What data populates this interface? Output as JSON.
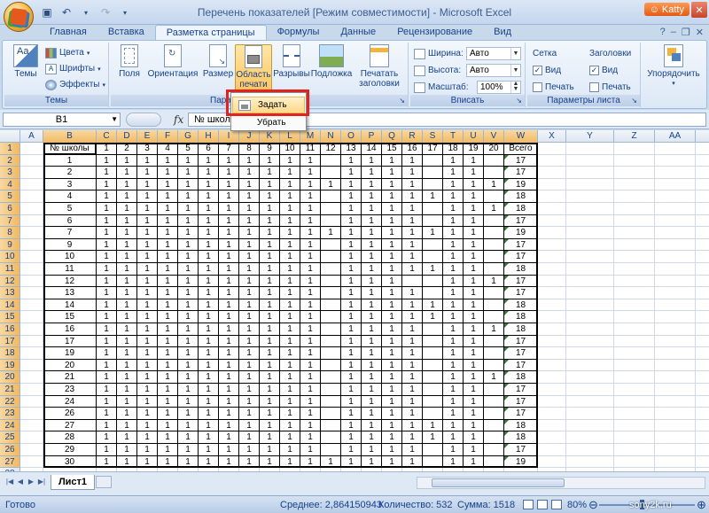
{
  "window": {
    "title": "Перечень показателей  [Режим совместимости] - Microsoft Excel",
    "user_badge": "Katty"
  },
  "ribbon": {
    "tabs": [
      "Главная",
      "Вставка",
      "Разметка страницы",
      "Формулы",
      "Данные",
      "Рецензирование",
      "Вид"
    ],
    "active_tab": "Разметка страницы",
    "themes": {
      "big_label": "Темы",
      "colors": "Цвета",
      "fonts": "Шрифты",
      "effects": "Эффекты",
      "group_label": "Темы"
    },
    "page_setup": {
      "margins": "Поля",
      "orientation": "Ориентация",
      "size": "Размер",
      "print_area": "Область печати",
      "breaks": "Разрывы",
      "background": "Подложка",
      "print_titles": "Печатать заголовки",
      "group_label": "Парам"
    },
    "fit": {
      "width_label": "Ширина:",
      "width_value": "Авто",
      "height_label": "Высота:",
      "height_value": "Авто",
      "scale_label": "Масштаб:",
      "scale_value": "100%",
      "group_label": "Вписать"
    },
    "sheet_options": {
      "gridlines": "Сетка",
      "headings": "Заголовки",
      "view": "Вид",
      "print": "Печать",
      "group_label": "Параметры листа"
    },
    "arrange": {
      "label": "Упорядочить"
    }
  },
  "print_area_menu": {
    "set": "Задать",
    "clear": "Убрать"
  },
  "formula_bar": {
    "name_box": "B1",
    "fx": "fx",
    "content": "№ школ"
  },
  "grid": {
    "columns": [
      "A",
      "B",
      "C",
      "D",
      "E",
      "F",
      "G",
      "H",
      "I",
      "J",
      "K",
      "L",
      "M",
      "N",
      "O",
      "P",
      "Q",
      "R",
      "S",
      "T",
      "U",
      "V",
      "W",
      "X",
      "Y",
      "Z",
      "AA",
      "AB"
    ],
    "header_row": [
      "№ школы",
      "1",
      "2",
      "3",
      "4",
      "5",
      "6",
      "7",
      "8",
      "9",
      "10",
      "11",
      "12",
      "13",
      "14",
      "15",
      "16",
      "17",
      "18",
      "19",
      "20",
      "Всего"
    ],
    "rows": [
      {
        "n": "1",
        "v": [
          "1",
          "1",
          "1",
          "1",
          "1",
          "1",
          "1",
          "1",
          "1",
          "1",
          "1",
          "",
          "1",
          "1",
          "1",
          "1",
          "",
          "1",
          "1",
          "",
          "17"
        ]
      },
      {
        "n": "2",
        "v": [
          "1",
          "1",
          "1",
          "1",
          "1",
          "1",
          "1",
          "1",
          "1",
          "1",
          "1",
          "",
          "1",
          "1",
          "1",
          "1",
          "",
          "1",
          "1",
          "",
          "17"
        ]
      },
      {
        "n": "3",
        "v": [
          "1",
          "1",
          "1",
          "1",
          "1",
          "1",
          "1",
          "1",
          "1",
          "1",
          "1",
          "1",
          "1",
          "1",
          "1",
          "1",
          "",
          "1",
          "1",
          "1",
          "19"
        ]
      },
      {
        "n": "4",
        "v": [
          "1",
          "1",
          "1",
          "1",
          "1",
          "1",
          "1",
          "1",
          "1",
          "1",
          "1",
          "",
          "1",
          "1",
          "1",
          "1",
          "1",
          "1",
          "1",
          "",
          "18"
        ]
      },
      {
        "n": "5",
        "v": [
          "1",
          "1",
          "1",
          "1",
          "1",
          "1",
          "1",
          "1",
          "1",
          "1",
          "1",
          "",
          "1",
          "1",
          "1",
          "1",
          "",
          "1",
          "1",
          "1",
          "18"
        ]
      },
      {
        "n": "6",
        "v": [
          "1",
          "1",
          "1",
          "1",
          "1",
          "1",
          "1",
          "1",
          "1",
          "1",
          "1",
          "",
          "1",
          "1",
          "1",
          "1",
          "",
          "1",
          "1",
          "",
          "17"
        ]
      },
      {
        "n": "7",
        "v": [
          "1",
          "1",
          "1",
          "1",
          "1",
          "1",
          "1",
          "1",
          "1",
          "1",
          "1",
          "1",
          "1",
          "1",
          "1",
          "1",
          "1",
          "1",
          "1",
          "",
          "19"
        ]
      },
      {
        "n": "9",
        "v": [
          "1",
          "1",
          "1",
          "1",
          "1",
          "1",
          "1",
          "1",
          "1",
          "1",
          "1",
          "",
          "1",
          "1",
          "1",
          "1",
          "",
          "1",
          "1",
          "",
          "17"
        ]
      },
      {
        "n": "10",
        "v": [
          "1",
          "1",
          "1",
          "1",
          "1",
          "1",
          "1",
          "1",
          "1",
          "1",
          "1",
          "",
          "1",
          "1",
          "1",
          "1",
          "",
          "1",
          "1",
          "",
          "17"
        ]
      },
      {
        "n": "11",
        "v": [
          "1",
          "1",
          "1",
          "1",
          "1",
          "1",
          "1",
          "1",
          "1",
          "1",
          "1",
          "",
          "1",
          "1",
          "1",
          "1",
          "1",
          "1",
          "1",
          "",
          "18"
        ]
      },
      {
        "n": "12",
        "v": [
          "1",
          "1",
          "1",
          "1",
          "1",
          "1",
          "1",
          "1",
          "1",
          "1",
          "1",
          "",
          "1",
          "1",
          "1",
          "",
          "",
          "1",
          "1",
          "1",
          "17"
        ]
      },
      {
        "n": "13",
        "v": [
          "1",
          "1",
          "1",
          "1",
          "1",
          "1",
          "1",
          "1",
          "1",
          "1",
          "1",
          "",
          "1",
          "1",
          "1",
          "1",
          "",
          "1",
          "1",
          "",
          "17"
        ]
      },
      {
        "n": "14",
        "v": [
          "1",
          "1",
          "1",
          "1",
          "1",
          "1",
          "1",
          "1",
          "1",
          "1",
          "1",
          "",
          "1",
          "1",
          "1",
          "1",
          "1",
          "1",
          "1",
          "",
          "18"
        ]
      },
      {
        "n": "15",
        "v": [
          "1",
          "1",
          "1",
          "1",
          "1",
          "1",
          "1",
          "1",
          "1",
          "1",
          "1",
          "",
          "1",
          "1",
          "1",
          "1",
          "1",
          "1",
          "1",
          "",
          "18"
        ]
      },
      {
        "n": "16",
        "v": [
          "1",
          "1",
          "1",
          "1",
          "1",
          "1",
          "1",
          "1",
          "1",
          "1",
          "1",
          "",
          "1",
          "1",
          "1",
          "1",
          "",
          "1",
          "1",
          "1",
          "18"
        ]
      },
      {
        "n": "17",
        "v": [
          "1",
          "1",
          "1",
          "1",
          "1",
          "1",
          "1",
          "1",
          "1",
          "1",
          "1",
          "",
          "1",
          "1",
          "1",
          "1",
          "",
          "1",
          "1",
          "",
          "17"
        ]
      },
      {
        "n": "19",
        "v": [
          "1",
          "1",
          "1",
          "1",
          "1",
          "1",
          "1",
          "1",
          "1",
          "1",
          "1",
          "",
          "1",
          "1",
          "1",
          "1",
          "",
          "1",
          "1",
          "",
          "17"
        ]
      },
      {
        "n": "20",
        "v": [
          "1",
          "1",
          "1",
          "1",
          "1",
          "1",
          "1",
          "1",
          "1",
          "1",
          "1",
          "",
          "1",
          "1",
          "1",
          "1",
          "",
          "1",
          "1",
          "",
          "17"
        ]
      },
      {
        "n": "21",
        "v": [
          "1",
          "1",
          "1",
          "1",
          "1",
          "1",
          "1",
          "1",
          "1",
          "1",
          "1",
          "",
          "1",
          "1",
          "1",
          "1",
          "",
          "1",
          "1",
          "1",
          "18"
        ]
      },
      {
        "n": "23",
        "v": [
          "1",
          "1",
          "1",
          "1",
          "1",
          "1",
          "1",
          "1",
          "1",
          "1",
          "1",
          "",
          "1",
          "1",
          "1",
          "1",
          "",
          "1",
          "1",
          "",
          "17"
        ]
      },
      {
        "n": "24",
        "v": [
          "1",
          "1",
          "1",
          "1",
          "1",
          "1",
          "1",
          "1",
          "1",
          "1",
          "1",
          "",
          "1",
          "1",
          "1",
          "1",
          "",
          "1",
          "1",
          "",
          "17"
        ]
      },
      {
        "n": "26",
        "v": [
          "1",
          "1",
          "1",
          "1",
          "1",
          "1",
          "1",
          "1",
          "1",
          "1",
          "1",
          "",
          "1",
          "1",
          "1",
          "1",
          "",
          "1",
          "1",
          "",
          "17"
        ]
      },
      {
        "n": "27",
        "v": [
          "1",
          "1",
          "1",
          "1",
          "1",
          "1",
          "1",
          "1",
          "1",
          "1",
          "1",
          "",
          "1",
          "1",
          "1",
          "1",
          "1",
          "1",
          "1",
          "",
          "18"
        ]
      },
      {
        "n": "28",
        "v": [
          "1",
          "1",
          "1",
          "1",
          "1",
          "1",
          "1",
          "1",
          "1",
          "1",
          "1",
          "",
          "1",
          "1",
          "1",
          "1",
          "1",
          "1",
          "1",
          "",
          "18"
        ]
      },
      {
        "n": "29",
        "v": [
          "1",
          "1",
          "1",
          "1",
          "1",
          "1",
          "1",
          "1",
          "1",
          "1",
          "1",
          "",
          "1",
          "1",
          "1",
          "1",
          "",
          "1",
          "1",
          "",
          "17"
        ]
      },
      {
        "n": "30",
        "v": [
          "1",
          "1",
          "1",
          "1",
          "1",
          "1",
          "1",
          "1",
          "1",
          "1",
          "1",
          "1",
          "1",
          "1",
          "1",
          "1",
          "",
          "1",
          "1",
          "",
          "19"
        ]
      }
    ]
  },
  "sheet_tab": "Лист1",
  "status": {
    "ready": "Готово",
    "average": "Среднее: 2,864150943",
    "count": "Количество: 532",
    "sum": "Сумма: 1518",
    "zoom": "80%",
    "watermark": "sony2k.ru"
  }
}
